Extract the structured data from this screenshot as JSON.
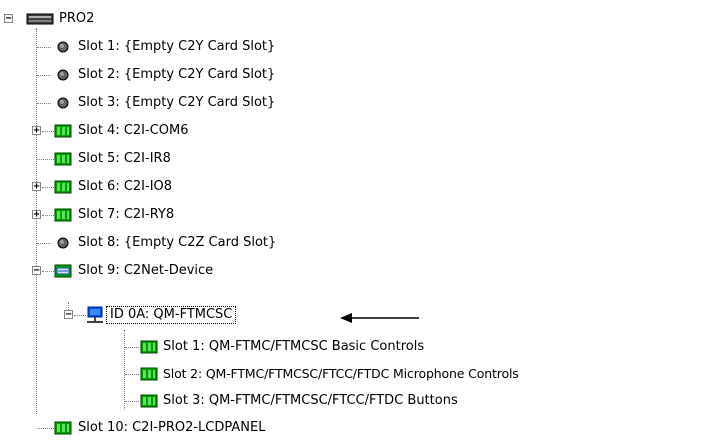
{
  "tree": {
    "root": {
      "label": "PRO2",
      "state": "expanded",
      "icon": "processor-icon"
    },
    "nodes": [
      {
        "label": "Slot 1: {Empty C2Y Card Slot}",
        "icon": "empty-slot-icon",
        "state": "leaf"
      },
      {
        "label": "Slot 2: {Empty C2Y Card Slot}",
        "icon": "empty-slot-icon",
        "state": "leaf"
      },
      {
        "label": "Slot 3: {Empty C2Y Card Slot}",
        "icon": "empty-slot-icon",
        "state": "leaf"
      },
      {
        "label": "Slot 4: C2I-COM6",
        "icon": "card-icon",
        "state": "collapsed"
      },
      {
        "label": "Slot 5: C2I-IR8",
        "icon": "card-icon",
        "state": "leaf"
      },
      {
        "label": "Slot 6: C2I-IO8",
        "icon": "card-icon",
        "state": "collapsed"
      },
      {
        "label": "Slot 7: C2I-RY8",
        "icon": "card-icon",
        "state": "collapsed"
      },
      {
        "label": "Slot 8: {Empty C2Z Card Slot}",
        "icon": "empty-slot-icon",
        "state": "leaf"
      },
      {
        "label": "Slot 9: C2Net-Device",
        "icon": "network-card-icon",
        "state": "expanded"
      },
      {
        "label": "ID 0A: QM-FTMCSC",
        "icon": "network-device-icon",
        "state": "expanded",
        "selected": true
      },
      {
        "label": "Slot 1: QM-FTMC/FTMCSC Basic Controls",
        "icon": "card-icon",
        "state": "leaf"
      },
      {
        "label": "Slot 2: QM-FTMC/FTMCSC/FTCC/FTDC Microphone Controls",
        "icon": "card-icon",
        "state": "leaf"
      },
      {
        "label": "Slot 3: QM-FTMC/FTMCSC/FTCC/FTDC Buttons",
        "icon": "card-icon",
        "state": "leaf"
      },
      {
        "label": "Slot 10: C2I-PRO2-LCDPANEL",
        "icon": "card-icon",
        "state": "leaf"
      }
    ]
  },
  "annotation": {
    "icon": "arrow-left-icon"
  },
  "colors": {
    "card_green": "#00a000",
    "card_dark": "#004000",
    "network_blue": "#0a4fd8",
    "line_gray": "#808080"
  }
}
